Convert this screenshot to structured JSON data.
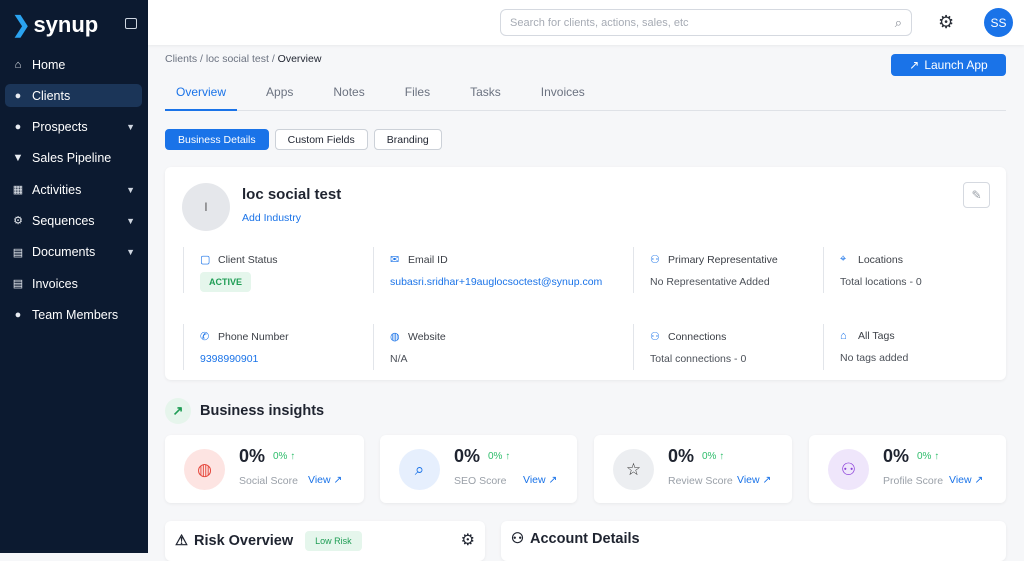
{
  "brand": "synup",
  "sidebar": {
    "items": [
      {
        "label": "Home",
        "icon": "home-icon"
      },
      {
        "label": "Clients",
        "icon": "user-icon",
        "active": true
      },
      {
        "label": "Prospects",
        "icon": "users-icon",
        "caret": true
      },
      {
        "label": "Sales Pipeline",
        "icon": "funnel-icon"
      },
      {
        "label": "Activities",
        "icon": "calendar-icon",
        "caret": true
      },
      {
        "label": "Sequences",
        "icon": "gear-icon",
        "caret": true
      },
      {
        "label": "Documents",
        "icon": "document-icon",
        "caret": true
      },
      {
        "label": "Invoices",
        "icon": "invoice-icon"
      },
      {
        "label": "Team Members",
        "icon": "team-icon"
      }
    ]
  },
  "header": {
    "search_placeholder": "Search for clients, actions, sales, etc",
    "avatar": "SS"
  },
  "breadcrumb": {
    "a": "Clients",
    "b": "loc social test",
    "c": "Overview",
    "sep": " / "
  },
  "launch": "Launch App",
  "tabs": [
    "Overview",
    "Apps",
    "Notes",
    "Files",
    "Tasks",
    "Invoices"
  ],
  "subtabs": [
    "Business Details",
    "Custom Fields",
    "Branding"
  ],
  "client": {
    "initial": "l",
    "name": "loc social test",
    "add_industry": "Add Industry"
  },
  "fields": [
    {
      "label": "Client Status",
      "value": "ACTIVE"
    },
    {
      "label": "Email ID",
      "value": "subasri.sridhar+19auglocsoctest@synup.com"
    },
    {
      "label": "Primary Representative",
      "value": "No Representative Added"
    },
    {
      "label": "Locations",
      "value": "Total locations - 0"
    },
    {
      "label": "Phone Number",
      "value": "9398990901"
    },
    {
      "label": "Website",
      "value": "N/A"
    },
    {
      "label": "Connections",
      "value": "Total connections - 0"
    },
    {
      "label": "All Tags",
      "value": "No tags added"
    }
  ],
  "insights": {
    "title": "Business insights",
    "scores": [
      {
        "pct": "0%",
        "delta": "0% ↑",
        "name": "Social Score",
        "view": "View",
        "color": "#fde4e2"
      },
      {
        "pct": "0%",
        "delta": "0% ↑",
        "name": "SEO Score",
        "view": "View",
        "color": "#e6effd"
      },
      {
        "pct": "0%",
        "delta": "0% ↑",
        "name": "Review Score",
        "view": "View",
        "color": "#eceef1"
      },
      {
        "pct": "0%",
        "delta": "0% ↑",
        "name": "Profile Score",
        "view": "View",
        "color": "#efe6fb"
      }
    ]
  },
  "risk": {
    "title": "Risk Overview",
    "badge": "Low Risk"
  },
  "account": {
    "title": "Account Details"
  }
}
